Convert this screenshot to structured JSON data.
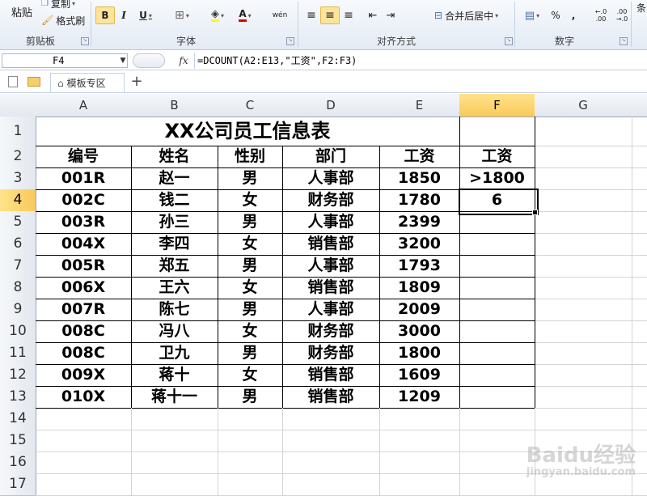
{
  "ribbon": {
    "clipboard": {
      "paste_label": "粘贴",
      "copy_label": "复制",
      "format_painter_label": "格式刷",
      "group_label": "剪贴板"
    },
    "font": {
      "bold": "B",
      "italic": "I",
      "underline": "U",
      "font_color_glyph": "A",
      "wen_glyph": "wén",
      "group_label": "字体"
    },
    "alignment": {
      "merge_center_label": "合并后居中",
      "group_label": "对齐方式"
    },
    "number": {
      "percent": "%",
      "comma": ",",
      "inc_decimal": "←.0\n.00",
      "dec_decimal": ".00\n→.0",
      "group_label": "数字"
    },
    "styles": {
      "partial_label": "条"
    }
  },
  "formula_bar": {
    "name_box": "F4",
    "fx_label": "fx",
    "formula": "=DCOUNT(A2:E13,\"工资\",F2:F3)"
  },
  "tab_bar": {
    "template_tab": "模板专区",
    "add_tab": "+"
  },
  "columns": [
    "A",
    "B",
    "C",
    "D",
    "E",
    "F",
    "G"
  ],
  "rows": [
    "1",
    "2",
    "3",
    "4",
    "5",
    "6",
    "7",
    "8",
    "9",
    "10",
    "11",
    "12",
    "13",
    "14",
    "15",
    "16",
    "17"
  ],
  "sheet": {
    "title": "XX公司员工信息表",
    "headers": [
      "编号",
      "姓名",
      "性别",
      "部门",
      "工资"
    ],
    "criteria_header": "工资",
    "criteria_value": ">1800",
    "result_value": "6",
    "data_rows": [
      [
        "001R",
        "赵一",
        "男",
        "人事部",
        "1850"
      ],
      [
        "002C",
        "钱二",
        "女",
        "财务部",
        "1780"
      ],
      [
        "003R",
        "孙三",
        "男",
        "人事部",
        "2399"
      ],
      [
        "004X",
        "李四",
        "女",
        "销售部",
        "3200"
      ],
      [
        "005R",
        "郑五",
        "男",
        "人事部",
        "1793"
      ],
      [
        "006X",
        "王六",
        "女",
        "销售部",
        "1809"
      ],
      [
        "007R",
        "陈七",
        "男",
        "人事部",
        "2009"
      ],
      [
        "008C",
        "冯八",
        "女",
        "财务部",
        "3000"
      ],
      [
        "008C",
        "卫九",
        "男",
        "财务部",
        "1800"
      ],
      [
        "009X",
        "蒋十",
        "女",
        "销售部",
        "1609"
      ],
      [
        "010X",
        "蒋十一",
        "男",
        "销售部",
        "1209"
      ]
    ]
  },
  "selection": {
    "active_cell": "F4",
    "active_column": "F",
    "active_row": "4"
  },
  "watermark": {
    "line1": "Baidu经验",
    "line2": "jingyan.baidu.com"
  },
  "colors": {
    "selected_header": "#f9c95a",
    "ribbon_active": "#fde49a",
    "grid_line": "#d4d4d4"
  }
}
